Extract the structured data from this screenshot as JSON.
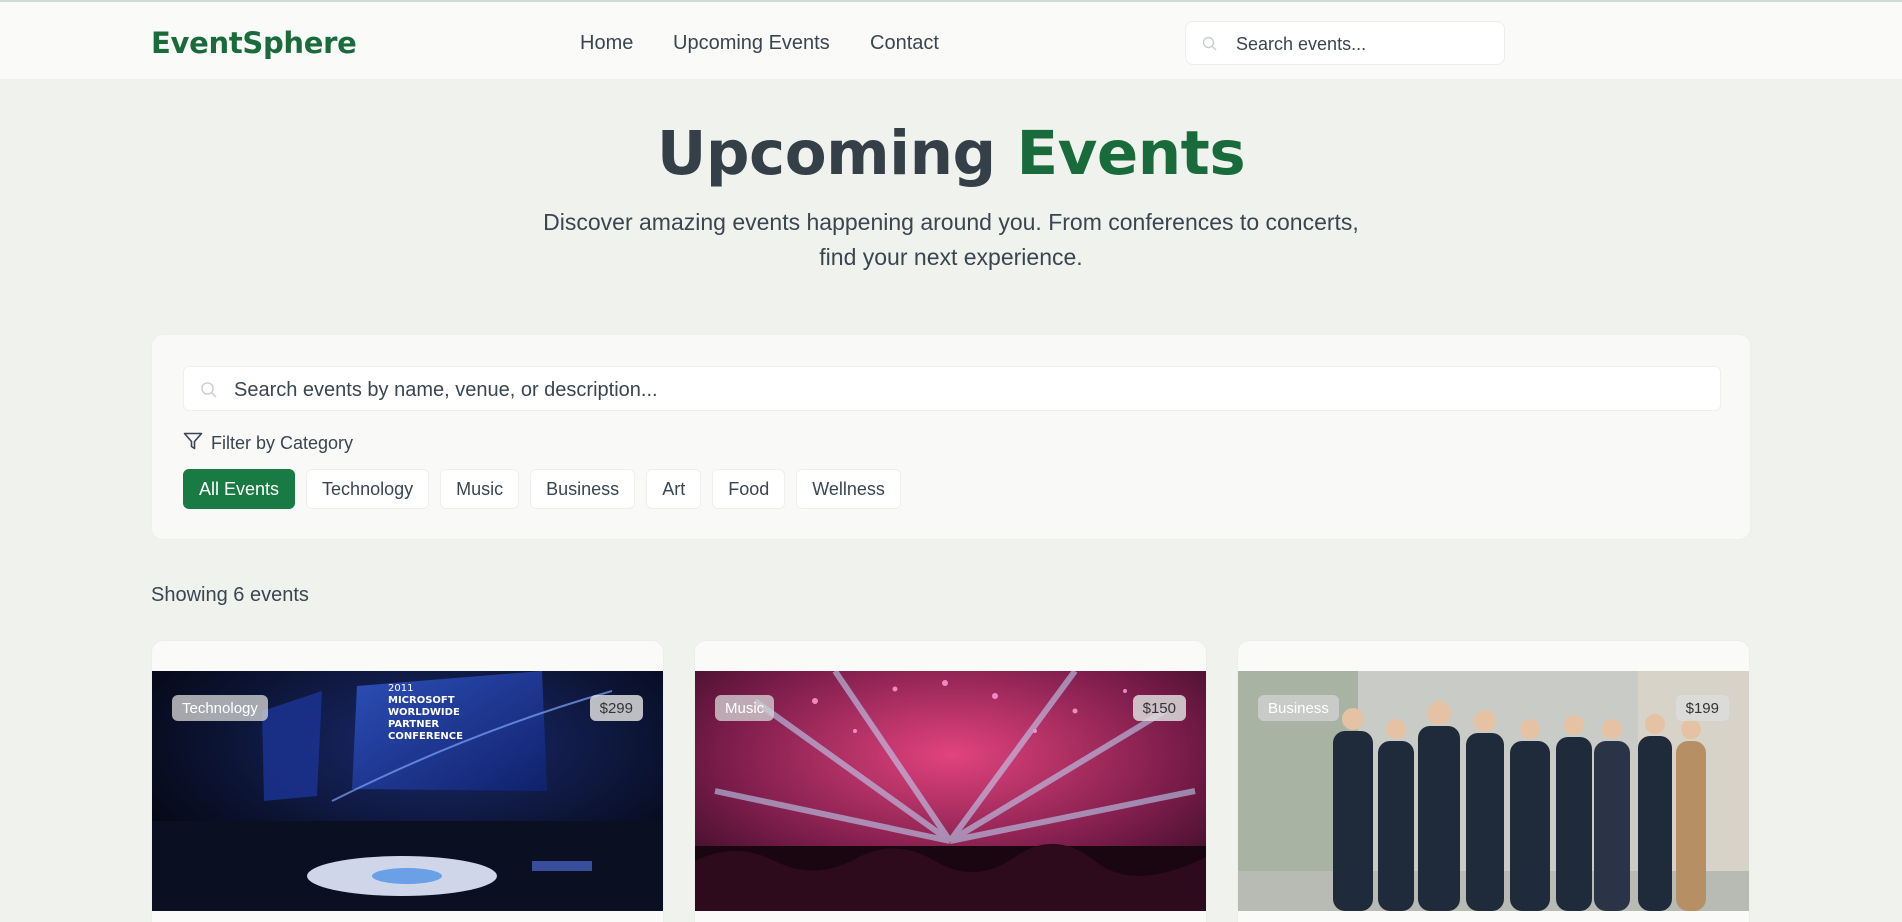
{
  "header": {
    "logo": "EventSphere",
    "nav": [
      "Home",
      "Upcoming Events",
      "Contact"
    ],
    "search_placeholder": "Search events..."
  },
  "hero": {
    "title_part1": "Upcoming",
    "title_part2": "Events",
    "subtitle_line1": "Discover amazing events happening around you. From conferences to concerts,",
    "subtitle_line2": "find your next experience."
  },
  "filters": {
    "search_placeholder": "Search events by name, venue, or description...",
    "label": "Filter by Category",
    "categories": [
      "All Events",
      "Technology",
      "Music",
      "Business",
      "Art",
      "Food",
      "Wellness"
    ],
    "active": "All Events"
  },
  "results": {
    "showing": "Showing 6 events"
  },
  "events": [
    {
      "category": "Technology",
      "price": "$299",
      "image_text": [
        "2011",
        "MICROSOFT",
        "WORLDWIDE",
        "PARTNER",
        "CONFERENCE"
      ]
    },
    {
      "category": "Music",
      "price": "$150"
    },
    {
      "category": "Business",
      "price": "$199"
    }
  ],
  "colors": {
    "brand": "#1a6b3c",
    "background": "#f0f2ee",
    "active_chip": "#1a7a44"
  }
}
